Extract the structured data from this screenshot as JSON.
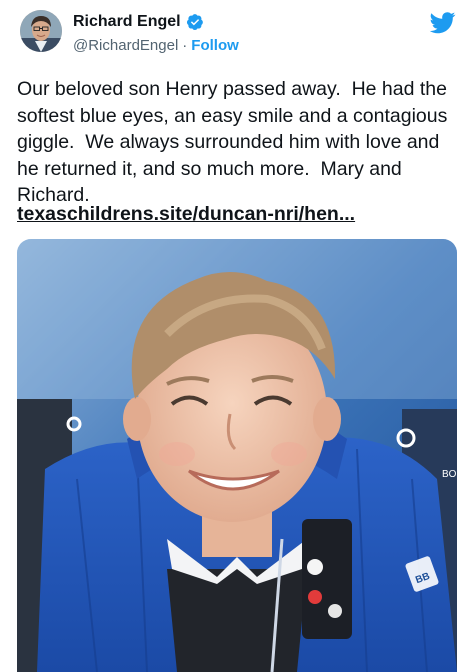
{
  "header": {
    "display_name": "Richard Engel",
    "handle": "@RichardEngel",
    "separator": "·",
    "follow_label": "Follow",
    "verified_color": "#1d9bf0",
    "avatar_icon": "avatar-photo",
    "logo_icon": "twitter-bird-icon"
  },
  "tweet": {
    "text": "Our beloved son Henry passed away.  He had the softest blue eyes, an easy smile and a contagious giggle.  We always surrounded him with love and he returned it, and so much more.  Mary and Richard.",
    "link": "texaschildrens.site/duncan-nri/hen..."
  },
  "media": {
    "description_icon": "photo-child-in-stroller",
    "stroller_letter_left": "O",
    "stroller_letter_right": "O",
    "stroller_brand_text": "BON",
    "jacket_badge_text": "BB"
  },
  "colors": {
    "accent": "#1d9bf0",
    "text": "#0f1419",
    "secondary": "#536471"
  }
}
